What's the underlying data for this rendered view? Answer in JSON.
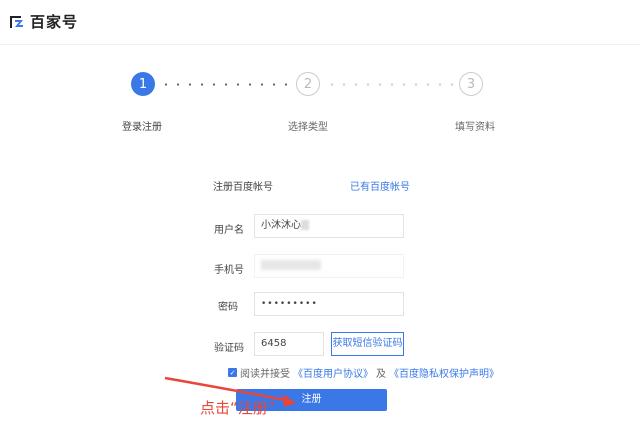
{
  "header": {
    "brand": "百家号"
  },
  "steps": [
    {
      "number": "1",
      "label": "登录注册",
      "active": true
    },
    {
      "number": "2",
      "label": "选择类型",
      "active": false
    },
    {
      "number": "3",
      "label": "填写资料",
      "active": false
    }
  ],
  "form": {
    "account_title": "注册百度帐号",
    "has_account_link": "已有百度帐号",
    "username_label": "用户名",
    "username_value": "小沐沐心",
    "phone_label": "手机号",
    "password_label": "密码",
    "password_value": "•••••••••",
    "code_label": "验证码",
    "code_value": "6458",
    "sms_button": "获取短信验证码",
    "agree_prefix": "阅读并接受",
    "agreement_link": "《百度用户协议》",
    "agree_and": "及",
    "privacy_link": "《百度隐私权保护声明》",
    "register_button": "注册"
  },
  "annotation": {
    "text": "点击“注册”",
    "color": "#e8463a"
  },
  "colors": {
    "accent": "#3a78e7"
  }
}
